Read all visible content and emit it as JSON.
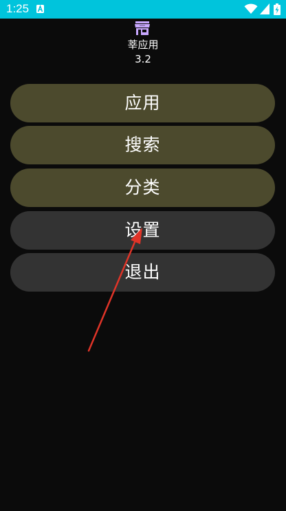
{
  "status_bar": {
    "time": "1:25",
    "color": "#00c4dc",
    "icons": [
      "notification-a-icon",
      "wifi-icon",
      "signal-icon",
      "battery-icon"
    ]
  },
  "header": {
    "icon": "storefront-icon",
    "icon_color": "#c9a8ff",
    "app_name": "莘应用",
    "version": "3.2"
  },
  "menu": {
    "items": [
      {
        "label": "应用",
        "style": "olive",
        "color": "#4c4a2d"
      },
      {
        "label": "搜索",
        "style": "olive",
        "color": "#4c4a2d"
      },
      {
        "label": "分类",
        "style": "olive",
        "color": "#4c4a2d"
      },
      {
        "label": "设置",
        "style": "gray",
        "color": "#333333"
      },
      {
        "label": "退出",
        "style": "gray",
        "color": "#333333"
      }
    ]
  },
  "annotation": {
    "type": "arrow",
    "color": "#e03428",
    "points_to": "设置"
  }
}
